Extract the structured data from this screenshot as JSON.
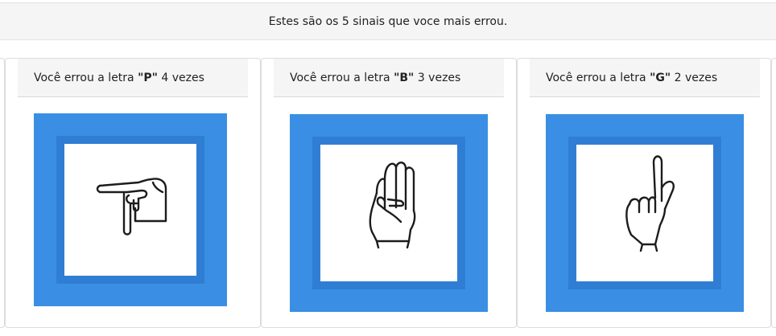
{
  "banner": {
    "text": "Estes são os 5 sinais que voce mais errou."
  },
  "cards": [
    {
      "prefix": "Você errou a letra",
      "letter": "\"P\"",
      "count_text": "4 vezes",
      "icon": "hand-sign-p-icon"
    },
    {
      "prefix": "Você errou a letra",
      "letter": "\"B\"",
      "count_text": "3 vezes",
      "icon": "hand-sign-b-icon"
    },
    {
      "prefix": "Você errou a letra",
      "letter": "\"G\"",
      "count_text": "2 vezes",
      "icon": "hand-sign-g-icon"
    }
  ],
  "colors": {
    "frame_blue": "#3a8fe4",
    "frame_inner": "#2f7ed3"
  }
}
